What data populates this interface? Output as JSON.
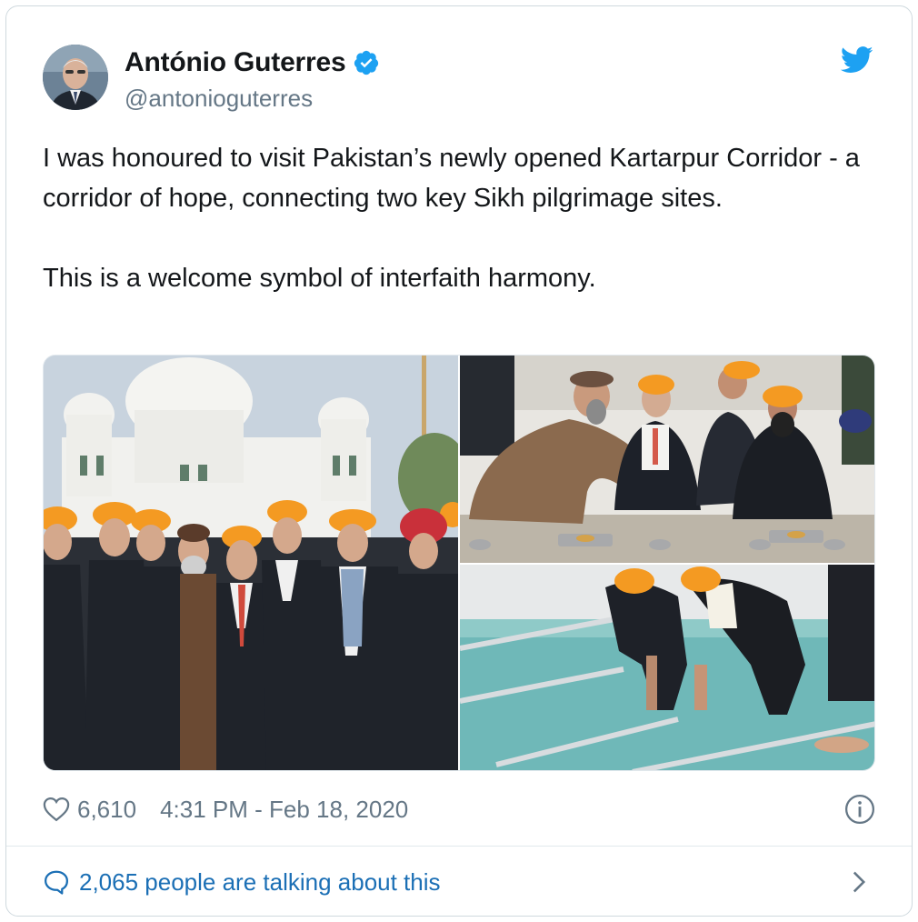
{
  "tweet": {
    "author": {
      "display_name": "António Guterres",
      "handle": "@antonioguterres",
      "verified": true
    },
    "text_paragraphs": [
      "I was honoured to visit Pakistan’s newly opened Kartarpur Corridor - a corridor of hope, connecting two key Sikh pilgrimage sites.",
      "This is a welcome symbol of interfaith harmony."
    ],
    "likes": "6,610",
    "timestamp": "4:31 PM - Feb 18, 2020",
    "conversation_link": "2,065 people are talking about this"
  },
  "icons": {
    "verified": "verified-badge-icon",
    "logo": "twitter-bird-icon",
    "like": "heart-icon",
    "info": "info-icon",
    "reply": "speech-bubble-icon",
    "more": "chevron-right-icon"
  },
  "colors": {
    "twitter_blue": "#1da1f2",
    "link_blue": "#1b6fb5",
    "text": "#14171a",
    "secondary_text": "#657786",
    "border": "#e1e8ed"
  }
}
